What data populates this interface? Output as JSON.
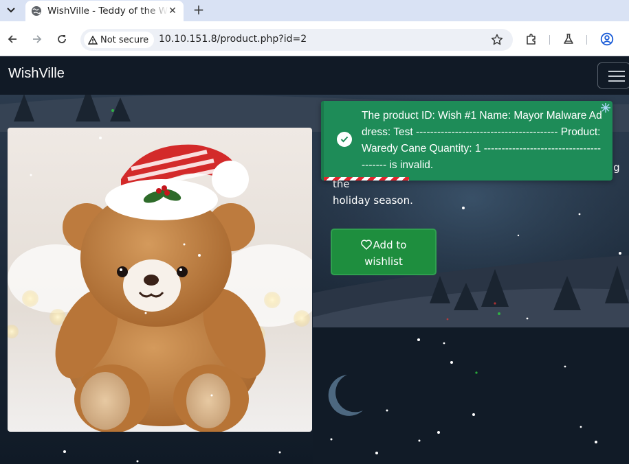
{
  "browser": {
    "tab": {
      "title": "WishVille - Teddy of the Week"
    },
    "omnibox": {
      "security_label": "Not secure",
      "url": "10.10.151.8/product.php?id=2"
    }
  },
  "site": {
    "brand": "WishVille"
  },
  "product": {
    "description_visible": "warmth and comfort to kids and grown-ups alike during the\nholiday season.",
    "wishlist_label_line1": "Add to",
    "wishlist_label_line2": "wishlist"
  },
  "toast": {
    "message": "The product ID: Wish #1 Name: Mayor Malware Address: Test ---------------------------------------- Product: Waredy Cane Quantity: 1 ---------------------------------------- is invalid.",
    "type": "success"
  },
  "colors": {
    "toast_bg": "#1e8c58",
    "button_bg": "#1e8e3e",
    "navbar_bg": "#111a26"
  }
}
